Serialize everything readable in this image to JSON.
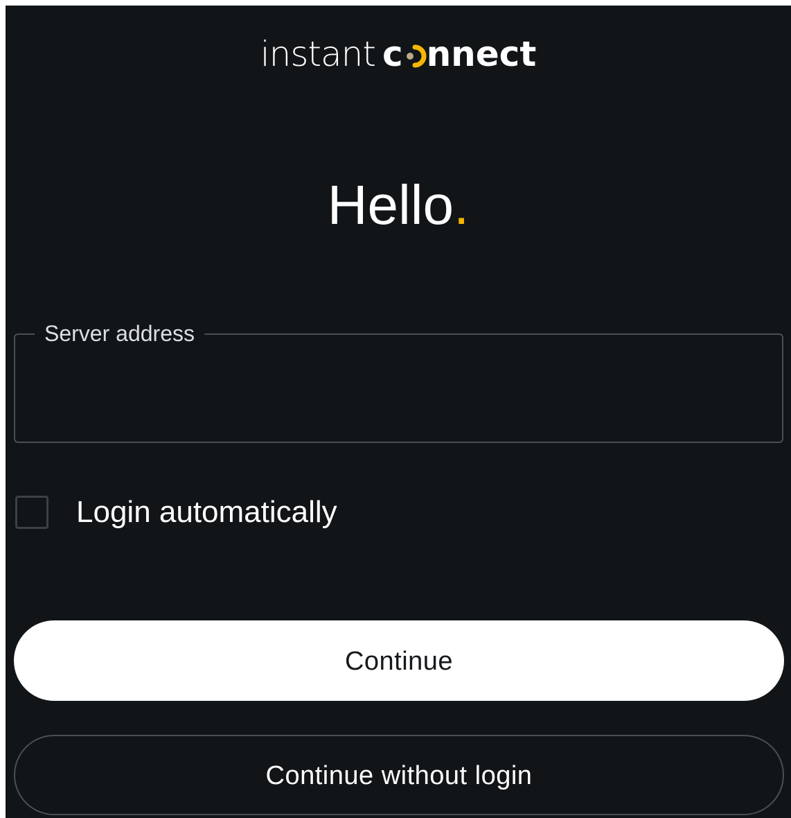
{
  "brand": {
    "logo_light": "instant",
    "logo_bold_prefix": "c",
    "logo_bold_suffix": "nnect",
    "logo_mark": "connect-o-mark-icon",
    "accent_color": "#f5b700",
    "mark_dot_color": "#b9a98a"
  },
  "greeting": {
    "text": "Hello",
    "punctuation": "."
  },
  "server_field": {
    "label": "Server address",
    "value": "",
    "placeholder": ""
  },
  "login_automatically": {
    "label": "Login automatically",
    "checked": false
  },
  "buttons": {
    "continue_label": "Continue",
    "continue_without_login_label": "Continue without login"
  },
  "colors": {
    "background": "#121518",
    "primary_button_bg": "#ffffff",
    "border": "#4a4f55"
  }
}
